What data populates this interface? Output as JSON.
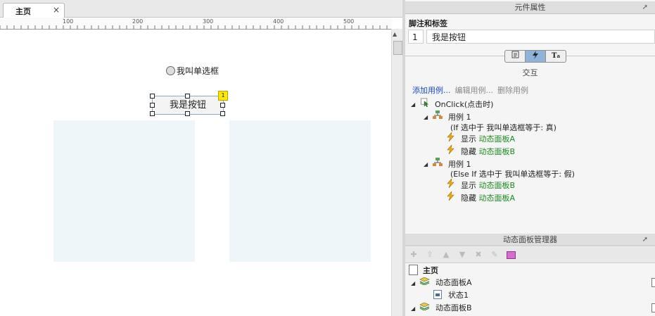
{
  "tabs": [
    {
      "label": "主页",
      "close": "×"
    }
  ],
  "ruler": {
    "labels": [
      "100",
      "200",
      "300",
      "400",
      "500"
    ]
  },
  "canvas": {
    "radio_label": "我叫单选框",
    "button_label": "我是按钮",
    "footnote_badge": "1"
  },
  "properties": {
    "panel_title": "元件属性",
    "section_title": "脚注和标签",
    "footnote_number": "1",
    "widget_label": "我是按钮",
    "segment_tabs": [
      "notes-icon",
      "interaction-icon",
      "style-icon"
    ],
    "interaction_title": "交互",
    "case_actions": {
      "add": "添加用例...",
      "edit": "编辑用例...",
      "delete": "删除用例"
    },
    "event": {
      "label": "OnClick(点击时)"
    },
    "cases": [
      {
        "name": "用例 1",
        "condition": "(If 选中于 我叫单选框等于: 真)",
        "actions": [
          {
            "verb": "显示",
            "target": "动态面板A"
          },
          {
            "verb": "隐藏",
            "target": "动态面板B"
          }
        ]
      },
      {
        "name": "用例 1",
        "condition": "(Else If 选中于 我叫单选框等于: 假)",
        "actions": [
          {
            "verb": "显示",
            "target": "动态面板B"
          },
          {
            "verb": "隐藏",
            "target": "动态面板A"
          }
        ]
      }
    ]
  },
  "panel_manager": {
    "title": "动态面板管理器",
    "toolbar_icons": [
      "add-state-icon",
      "move-up-icon",
      "arrow-up-icon",
      "arrow-down-icon",
      "delete-icon",
      "edit-icon",
      "page-icon"
    ],
    "page_name": "主页",
    "panels": [
      {
        "name": "动态面板A",
        "states": [
          "状态1"
        ]
      },
      {
        "name": "动态面板B",
        "states": []
      }
    ]
  },
  "colors": {
    "link": "#1a49c7",
    "action_target": "#1c8a1c",
    "panel_fill": "#eff6f9",
    "badge": "#ffe800"
  }
}
